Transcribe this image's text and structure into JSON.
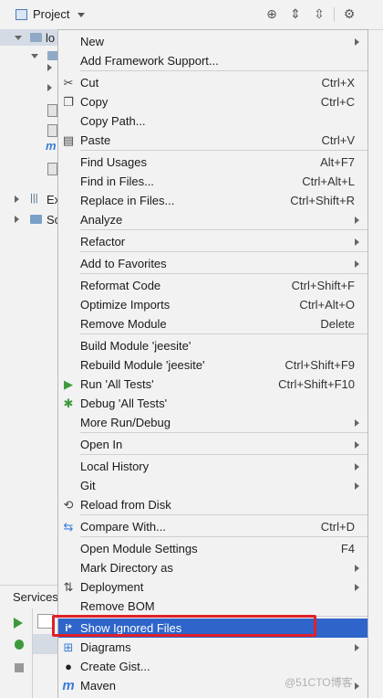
{
  "project_panel": {
    "title": "Project",
    "tree_rows": [
      {
        "label": "lo"
      },
      {
        "label": ""
      },
      {
        "label": ""
      },
      {
        "label": ""
      },
      {
        "label": ""
      },
      {
        "label": ""
      },
      {
        "label": ""
      },
      {
        "label": ""
      },
      {
        "label": "Ex"
      },
      {
        "label": "Sc"
      }
    ]
  },
  "services": {
    "label": "Services"
  },
  "menu": {
    "items": [
      {
        "label": "New",
        "shortcut": "",
        "submenu": true,
        "icon": ""
      },
      {
        "label": "Add Framework Support...",
        "shortcut": "",
        "submenu": false,
        "icon": ""
      },
      {
        "label": "Cut",
        "shortcut": "Ctrl+X",
        "submenu": false,
        "icon": "cut-icon"
      },
      {
        "label": "Copy",
        "shortcut": "Ctrl+C",
        "submenu": false,
        "icon": "copy-icon"
      },
      {
        "label": "Copy Path...",
        "shortcut": "",
        "submenu": false,
        "icon": ""
      },
      {
        "label": "Paste",
        "shortcut": "Ctrl+V",
        "submenu": false,
        "icon": "paste-icon"
      },
      {
        "label": "Find Usages",
        "shortcut": "Alt+F7",
        "submenu": false,
        "icon": ""
      },
      {
        "label": "Find in Files...",
        "shortcut": "Ctrl+Alt+L",
        "submenu": false,
        "icon": ""
      },
      {
        "label": "Replace in Files...",
        "shortcut": "Ctrl+Shift+R",
        "submenu": false,
        "icon": ""
      },
      {
        "label": "Analyze",
        "shortcut": "",
        "submenu": true,
        "icon": ""
      },
      {
        "label": "Refactor",
        "shortcut": "",
        "submenu": true,
        "icon": ""
      },
      {
        "label": "Add to Favorites",
        "shortcut": "",
        "submenu": true,
        "icon": ""
      },
      {
        "label": "Reformat Code",
        "shortcut": "Ctrl+Shift+F",
        "submenu": false,
        "icon": ""
      },
      {
        "label": "Optimize Imports",
        "shortcut": "Ctrl+Alt+O",
        "submenu": false,
        "icon": ""
      },
      {
        "label": "Remove Module",
        "shortcut": "Delete",
        "submenu": false,
        "icon": ""
      },
      {
        "label": "Build Module 'jeesite'",
        "shortcut": "",
        "submenu": false,
        "icon": ""
      },
      {
        "label": "Rebuild Module 'jeesite'",
        "shortcut": "Ctrl+Shift+F9",
        "submenu": false,
        "icon": ""
      },
      {
        "label": "Run 'All Tests'",
        "shortcut": "Ctrl+Shift+F10",
        "submenu": false,
        "icon": "run-icon"
      },
      {
        "label": "Debug 'All Tests'",
        "shortcut": "",
        "submenu": false,
        "icon": "debug-icon"
      },
      {
        "label": "More Run/Debug",
        "shortcut": "",
        "submenu": true,
        "icon": ""
      },
      {
        "label": "Open In",
        "shortcut": "",
        "submenu": true,
        "icon": ""
      },
      {
        "label": "Local History",
        "shortcut": "",
        "submenu": true,
        "icon": ""
      },
      {
        "label": "Git",
        "shortcut": "",
        "submenu": true,
        "icon": ""
      },
      {
        "label": "Reload from Disk",
        "shortcut": "",
        "submenu": false,
        "icon": "reload-icon"
      },
      {
        "label": "Compare With...",
        "shortcut": "Ctrl+D",
        "submenu": false,
        "icon": "compare-icon"
      },
      {
        "label": "Open Module Settings",
        "shortcut": "F4",
        "submenu": false,
        "icon": ""
      },
      {
        "label": "Mark Directory as",
        "shortcut": "",
        "submenu": true,
        "icon": ""
      },
      {
        "label": "Deployment",
        "shortcut": "",
        "submenu": true,
        "icon": "deployment-icon"
      },
      {
        "label": "Remove BOM",
        "shortcut": "",
        "submenu": false,
        "icon": ""
      },
      {
        "label": "Show Ignored Files",
        "shortcut": "",
        "submenu": false,
        "icon": "ignored-files-icon",
        "highlighted": true
      },
      {
        "label": "Diagrams",
        "shortcut": "",
        "submenu": true,
        "icon": "diagrams-icon"
      },
      {
        "label": "Create Gist...",
        "shortcut": "",
        "submenu": false,
        "icon": "github-icon"
      },
      {
        "label": "Maven",
        "shortcut": "",
        "submenu": true,
        "icon": "maven-icon"
      }
    ]
  },
  "watermark": "@51CTO博客",
  "colors": {
    "menu_bg": "#f2f2f2",
    "selection": "#2f65ca",
    "annotation_box": "#e0202a"
  }
}
